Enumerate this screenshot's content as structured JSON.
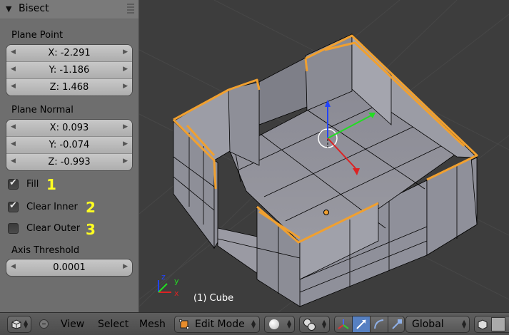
{
  "operator_panel": {
    "title": "Bisect",
    "plane_point": {
      "label": "Plane Point",
      "x": "X: -2.291",
      "y": "Y: -1.186",
      "z": "Z: 1.468"
    },
    "plane_normal": {
      "label": "Plane Normal",
      "x": "X: 0.093",
      "y": "Y: -0.074",
      "z": "Z: -0.993"
    },
    "fill": {
      "label": "Fill",
      "checked": true
    },
    "clear_inner": {
      "label": "Clear Inner",
      "checked": true
    },
    "clear_outer": {
      "label": "Clear Outer",
      "checked": false
    },
    "axis_threshold": {
      "label": "Axis Threshold",
      "value": "0.0001"
    }
  },
  "annotations": [
    "1",
    "2",
    "3"
  ],
  "annotation_color": "#ffff22",
  "viewport": {
    "object_info": "(1) Cube",
    "axis_labels": {
      "x": "x",
      "y": "y",
      "z": "z"
    },
    "selection_color": "#f0a030"
  },
  "toolbar": {
    "menus": [
      "View",
      "Select",
      "Mesh"
    ],
    "mode": "Edit Mode",
    "orientation": "Global"
  }
}
